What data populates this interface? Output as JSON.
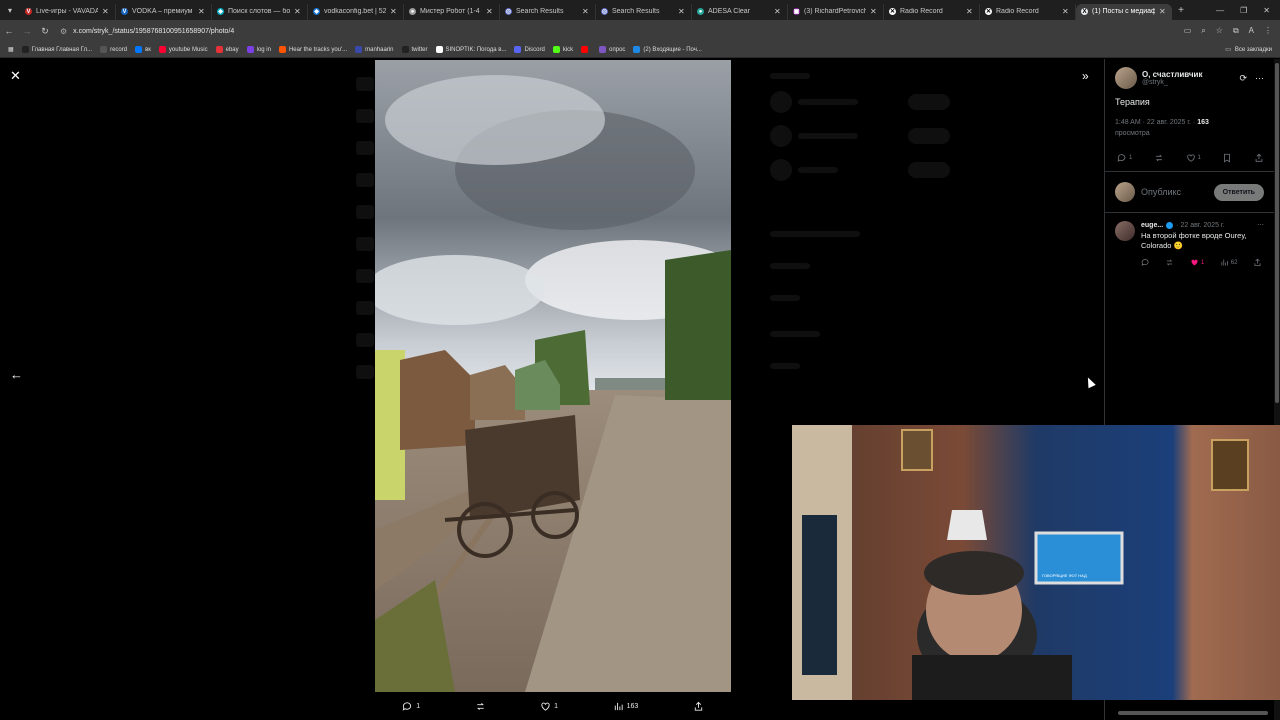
{
  "browser": {
    "tabs": [
      {
        "title": "Live-игры - VAVADA C",
        "color": "#c62828",
        "glyph": "V"
      },
      {
        "title": "VODKA – премиум он",
        "color": "#1565c0",
        "glyph": "V"
      },
      {
        "title": "Поиск слотов — бол",
        "color": "#00acc1",
        "glyph": "◆"
      },
      {
        "title": "vodkaconfig.bet | 520",
        "color": "#1976d2",
        "glyph": "◆"
      },
      {
        "title": "Мистер Робот (1-4 се",
        "color": "#9e9e9e",
        "glyph": "●"
      },
      {
        "title": "Search Results",
        "color": "#5c6bc0",
        "glyph": "◎"
      },
      {
        "title": "Search Results",
        "color": "#5c6bc0",
        "glyph": "◎"
      },
      {
        "title": "ADESA Clear",
        "color": "#26a69a",
        "glyph": "●"
      },
      {
        "title": "(3) RichardPetrovich",
        "color": "#8e24aa",
        "glyph": "▣"
      },
      {
        "title": "Radio Record",
        "color": "#fafafa",
        "glyph": "✕"
      },
      {
        "title": "Radio Record",
        "color": "#fafafa",
        "glyph": "✕"
      },
      {
        "title": "(1) Посты с медиафа",
        "color": "#e7e9ea",
        "glyph": "X"
      }
    ],
    "url": "x.com/stryk_/status/1958768100951658907/photo/4",
    "bookmarks": [
      {
        "label": "Главная Главная Гл...",
        "color": "#222"
      },
      {
        "label": "record",
        "color": "#555"
      },
      {
        "label": "вк",
        "color": "#0077ff"
      },
      {
        "label": "youtube Music",
        "color": "#ff0033"
      },
      {
        "label": "ebay",
        "color": "#e53238"
      },
      {
        "label": "log in",
        "color": "#7b3fe4"
      },
      {
        "label": "Hear the tracks you'...",
        "color": "#ff5500"
      },
      {
        "label": "manhaarin",
        "color": "#3949ab"
      },
      {
        "label": "twitter",
        "color": "#222"
      },
      {
        "label": "SINOPTIK: Погода в...",
        "color": "#fff"
      },
      {
        "label": "Discord",
        "color": "#5865f2"
      },
      {
        "label": "kick",
        "color": "#53fc18"
      },
      {
        "label": "",
        "color": "#ff0000"
      },
      {
        "label": "опрос",
        "color": "#7e57c2"
      },
      {
        "label": "(2) Входящие - Поч...",
        "color": "#1e88e5"
      }
    ],
    "all_bookmarks": "Все закладки"
  },
  "viewer": {
    "photo_actions": {
      "replies": "1",
      "reposts": "",
      "likes": "1",
      "views": "163"
    }
  },
  "tweet": {
    "display_name": "О, счастливчик",
    "handle": "@stryk_",
    "text": "Терапия",
    "time": "1:48 AM · 22 авг. 2025 г. · ",
    "views_count": "163",
    "views_label": "просмотра",
    "replies": "1",
    "likes": "1",
    "reply_placeholder": "Опубликс",
    "reply_button": "Ответить"
  },
  "comment": {
    "name": "euge...",
    "date": "· 22 авг. 2025 г.",
    "text": "На второй фотке вроде Ourey, Colorado 🙂",
    "likes": "1",
    "views": "62"
  },
  "cam": {
    "tv_text": "ГОВОРЯЩИЕ ФОТ НАД"
  }
}
